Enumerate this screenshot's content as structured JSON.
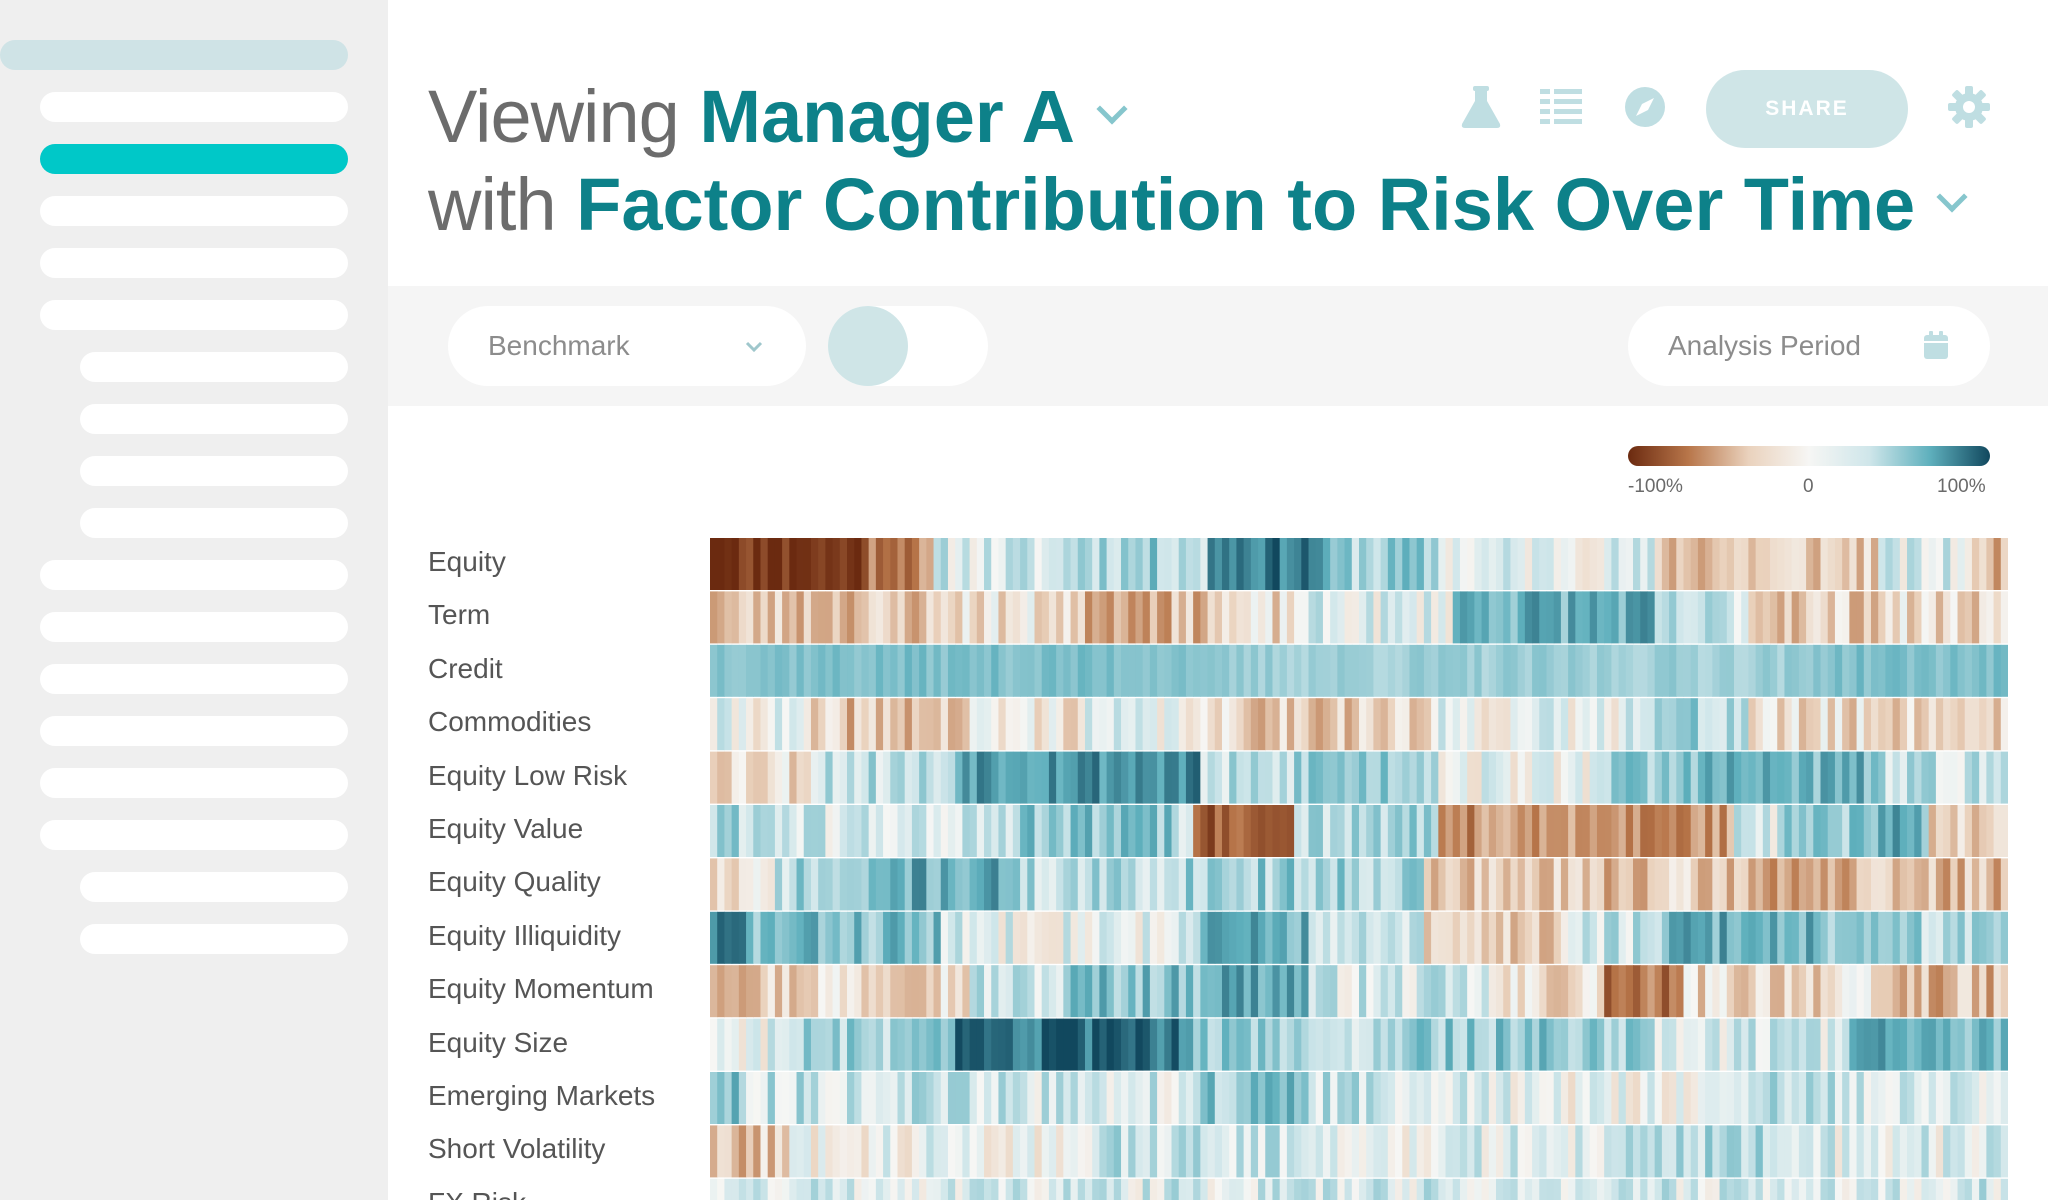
{
  "header": {
    "title_prefix_1": "Viewing",
    "manager": "Manager A",
    "title_prefix_2": "with",
    "view": "Factor Contribution to Risk Over Time",
    "share_label": "SHARE",
    "icons": [
      "flask-icon",
      "list-icon",
      "compass-icon",
      "gear-icon"
    ]
  },
  "filters": {
    "benchmark_placeholder": "Benchmark",
    "analysis_period_placeholder": "Analysis Period"
  },
  "legend": {
    "min_label": "-100%",
    "mid_label": "0",
    "max_label": "100%"
  },
  "colors": {
    "accent": "#0d8189",
    "active_nav": "#00c8c8",
    "negative_extreme": "#6b2a10",
    "positive_extreme": "#11485e"
  },
  "chart_data": {
    "type": "heatmap",
    "title": "",
    "value_range": [
      -100,
      100
    ],
    "rows": [
      {
        "name": "Equity",
        "seed": 11,
        "bands": [
          [
            0,
            0.12,
            -90
          ],
          [
            0.12,
            0.17,
            -50
          ],
          [
            0.17,
            0.27,
            15
          ],
          [
            0.27,
            0.38,
            35
          ],
          [
            0.385,
            0.47,
            80
          ],
          [
            0.47,
            0.56,
            35
          ],
          [
            0.56,
            0.73,
            10
          ],
          [
            0.73,
            0.78,
            -25
          ],
          [
            0.78,
            0.9,
            -20
          ],
          [
            0.9,
            0.97,
            10
          ],
          [
            0.97,
            1,
            -30
          ]
        ]
      },
      {
        "name": "Term",
        "seed": 23,
        "bands": [
          [
            0,
            0.02,
            -30
          ],
          [
            0.02,
            0.18,
            -25
          ],
          [
            0.18,
            0.28,
            -10
          ],
          [
            0.28,
            0.38,
            -30
          ],
          [
            0.38,
            0.45,
            -15
          ],
          [
            0.45,
            0.57,
            10
          ],
          [
            0.57,
            0.73,
            55
          ],
          [
            0.73,
            0.8,
            20
          ],
          [
            0.8,
            0.9,
            -20
          ],
          [
            0.9,
            1,
            -15
          ]
        ]
      },
      {
        "name": "Credit",
        "seed": 37,
        "bands": [
          [
            0,
            0.38,
            45
          ],
          [
            0.38,
            0.85,
            35
          ],
          [
            0.85,
            1,
            45
          ]
        ]
      },
      {
        "name": "Commodities",
        "seed": 41,
        "bands": [
          [
            0,
            0.07,
            5
          ],
          [
            0.07,
            0.2,
            -25
          ],
          [
            0.2,
            0.29,
            -5
          ],
          [
            0.29,
            0.38,
            5
          ],
          [
            0.38,
            0.56,
            -20
          ],
          [
            0.56,
            0.7,
            5
          ],
          [
            0.7,
            0.8,
            30
          ],
          [
            0.8,
            1,
            -15
          ]
        ]
      },
      {
        "name": "Equity Low Risk",
        "seed": 53,
        "bands": [
          [
            0,
            0.08,
            -10
          ],
          [
            0.08,
            0.19,
            25
          ],
          [
            0.19,
            0.38,
            70
          ],
          [
            0.38,
            0.45,
            20
          ],
          [
            0.45,
            0.56,
            40
          ],
          [
            0.56,
            0.68,
            5
          ],
          [
            0.68,
            0.75,
            35
          ],
          [
            0.75,
            0.9,
            50
          ],
          [
            0.9,
            1,
            20
          ]
        ]
      },
      {
        "name": "Equity Value",
        "seed": 61,
        "bands": [
          [
            0,
            0.06,
            30
          ],
          [
            0.06,
            0.24,
            15
          ],
          [
            0.24,
            0.36,
            40
          ],
          [
            0.36,
            0.37,
            10
          ],
          [
            0.37,
            0.45,
            -70
          ],
          [
            0.45,
            0.56,
            30
          ],
          [
            0.56,
            0.79,
            -45
          ],
          [
            0.79,
            0.83,
            15
          ],
          [
            0.83,
            0.9,
            35
          ],
          [
            0.9,
            0.94,
            55
          ],
          [
            0.94,
            1,
            -20
          ]
        ]
      },
      {
        "name": "Equity Quality",
        "seed": 71,
        "bands": [
          [
            0,
            0.05,
            -15
          ],
          [
            0.05,
            0.13,
            30
          ],
          [
            0.13,
            0.24,
            55
          ],
          [
            0.24,
            0.36,
            25
          ],
          [
            0.36,
            0.55,
            35
          ],
          [
            0.55,
            0.8,
            -25
          ],
          [
            0.8,
            0.89,
            -35
          ],
          [
            0.89,
            1,
            -30
          ]
        ]
      },
      {
        "name": "Equity Illiquidity",
        "seed": 83,
        "bands": [
          [
            0,
            0.03,
            75
          ],
          [
            0.03,
            0.18,
            45
          ],
          [
            0.18,
            0.38,
            10
          ],
          [
            0.38,
            0.46,
            55
          ],
          [
            0.46,
            0.55,
            15
          ],
          [
            0.55,
            0.66,
            -20
          ],
          [
            0.66,
            0.74,
            20
          ],
          [
            0.74,
            0.86,
            55
          ],
          [
            0.86,
            1,
            30
          ]
        ]
      },
      {
        "name": "Equity Momentum",
        "seed": 97,
        "bands": [
          [
            0,
            0.07,
            -20
          ],
          [
            0.07,
            0.2,
            -10
          ],
          [
            0.2,
            0.28,
            20
          ],
          [
            0.28,
            0.38,
            45
          ],
          [
            0.38,
            0.46,
            60
          ],
          [
            0.46,
            0.6,
            15
          ],
          [
            0.6,
            0.69,
            -15
          ],
          [
            0.69,
            0.75,
            -60
          ],
          [
            0.75,
            0.9,
            -15
          ],
          [
            0.9,
            1,
            -30
          ]
        ]
      },
      {
        "name": "Equity Size",
        "seed": 103,
        "bands": [
          [
            0,
            0.06,
            10
          ],
          [
            0.06,
            0.19,
            30
          ],
          [
            0.19,
            0.37,
            80
          ],
          [
            0.37,
            0.47,
            35
          ],
          [
            0.47,
            0.54,
            20
          ],
          [
            0.54,
            0.73,
            40
          ],
          [
            0.73,
            0.88,
            15
          ],
          [
            0.88,
            1,
            50
          ]
        ]
      },
      {
        "name": "Emerging Markets",
        "seed": 113,
        "bands": [
          [
            0,
            0.02,
            45
          ],
          [
            0.02,
            0.22,
            20
          ],
          [
            0.22,
            0.38,
            15
          ],
          [
            0.38,
            0.46,
            40
          ],
          [
            0.46,
            0.6,
            20
          ],
          [
            0.6,
            0.8,
            5
          ],
          [
            0.8,
            0.97,
            20
          ],
          [
            0.97,
            1,
            5
          ]
        ]
      },
      {
        "name": "Short Volatility",
        "seed": 127,
        "bands": [
          [
            0,
            0.06,
            -25
          ],
          [
            0.06,
            0.3,
            5
          ],
          [
            0.3,
            0.48,
            20
          ],
          [
            0.48,
            0.7,
            10
          ],
          [
            0.7,
            0.82,
            30
          ],
          [
            0.82,
            1,
            10
          ]
        ]
      },
      {
        "name": "FX Risk",
        "seed": 131,
        "bands": [
          [
            0,
            1,
            15
          ]
        ]
      }
    ]
  }
}
